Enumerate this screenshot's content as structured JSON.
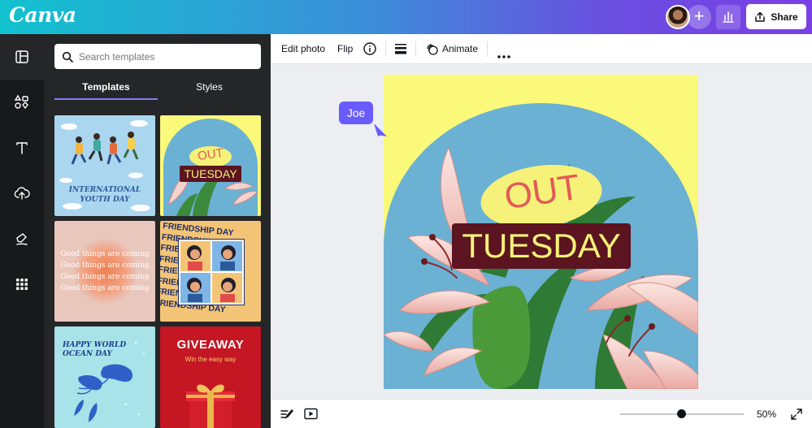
{
  "app": {
    "logo": "Canva"
  },
  "header": {
    "share_label": "Share"
  },
  "sidebar_rail": {
    "items": [
      {
        "name": "design",
        "icon": "layout-icon"
      },
      {
        "name": "elements",
        "icon": "shapes-icon"
      },
      {
        "name": "text",
        "icon": "text-icon"
      },
      {
        "name": "uploads",
        "icon": "upload-icon"
      },
      {
        "name": "draw",
        "icon": "draw-icon"
      },
      {
        "name": "apps",
        "icon": "apps-grid-icon"
      }
    ]
  },
  "panel": {
    "search_placeholder": "Search templates",
    "tabs": [
      {
        "label": "Templates",
        "active": true
      },
      {
        "label": "Styles",
        "active": false
      }
    ],
    "templates": {
      "youth": "International youth day",
      "tuesday_out": "OUT",
      "tuesday_main": "TUESDAY",
      "good_things": [
        "Good things are coming",
        "Good things are coming",
        "Good things are coming",
        "Good things are coming"
      ],
      "friendship": "FRIENDSHIP DAY",
      "ocean": [
        "HAPPY WORLD",
        "OCEAN DAY"
      ],
      "giveaway_title": "GIVEAWAY",
      "giveaway_sub": "Win the easy way"
    }
  },
  "toolbar": {
    "edit_photo": "Edit photo",
    "flip": "Flip",
    "animate": "Animate"
  },
  "design": {
    "out": "OUT",
    "tuesday": "TUESDAY"
  },
  "collaborator": {
    "name": "Joe"
  },
  "bottombar": {
    "zoom": "50%",
    "zoom_fraction": 0.5
  },
  "colors": {
    "accent": "#7b3fe6",
    "canvas_bg": "#fbf97a",
    "sky": "#6bb1d3",
    "label_yellow": "#f6f279",
    "out_red": "#e45a55",
    "tuesday_bg": "#5b1420",
    "cursor": "#6a5bff"
  }
}
